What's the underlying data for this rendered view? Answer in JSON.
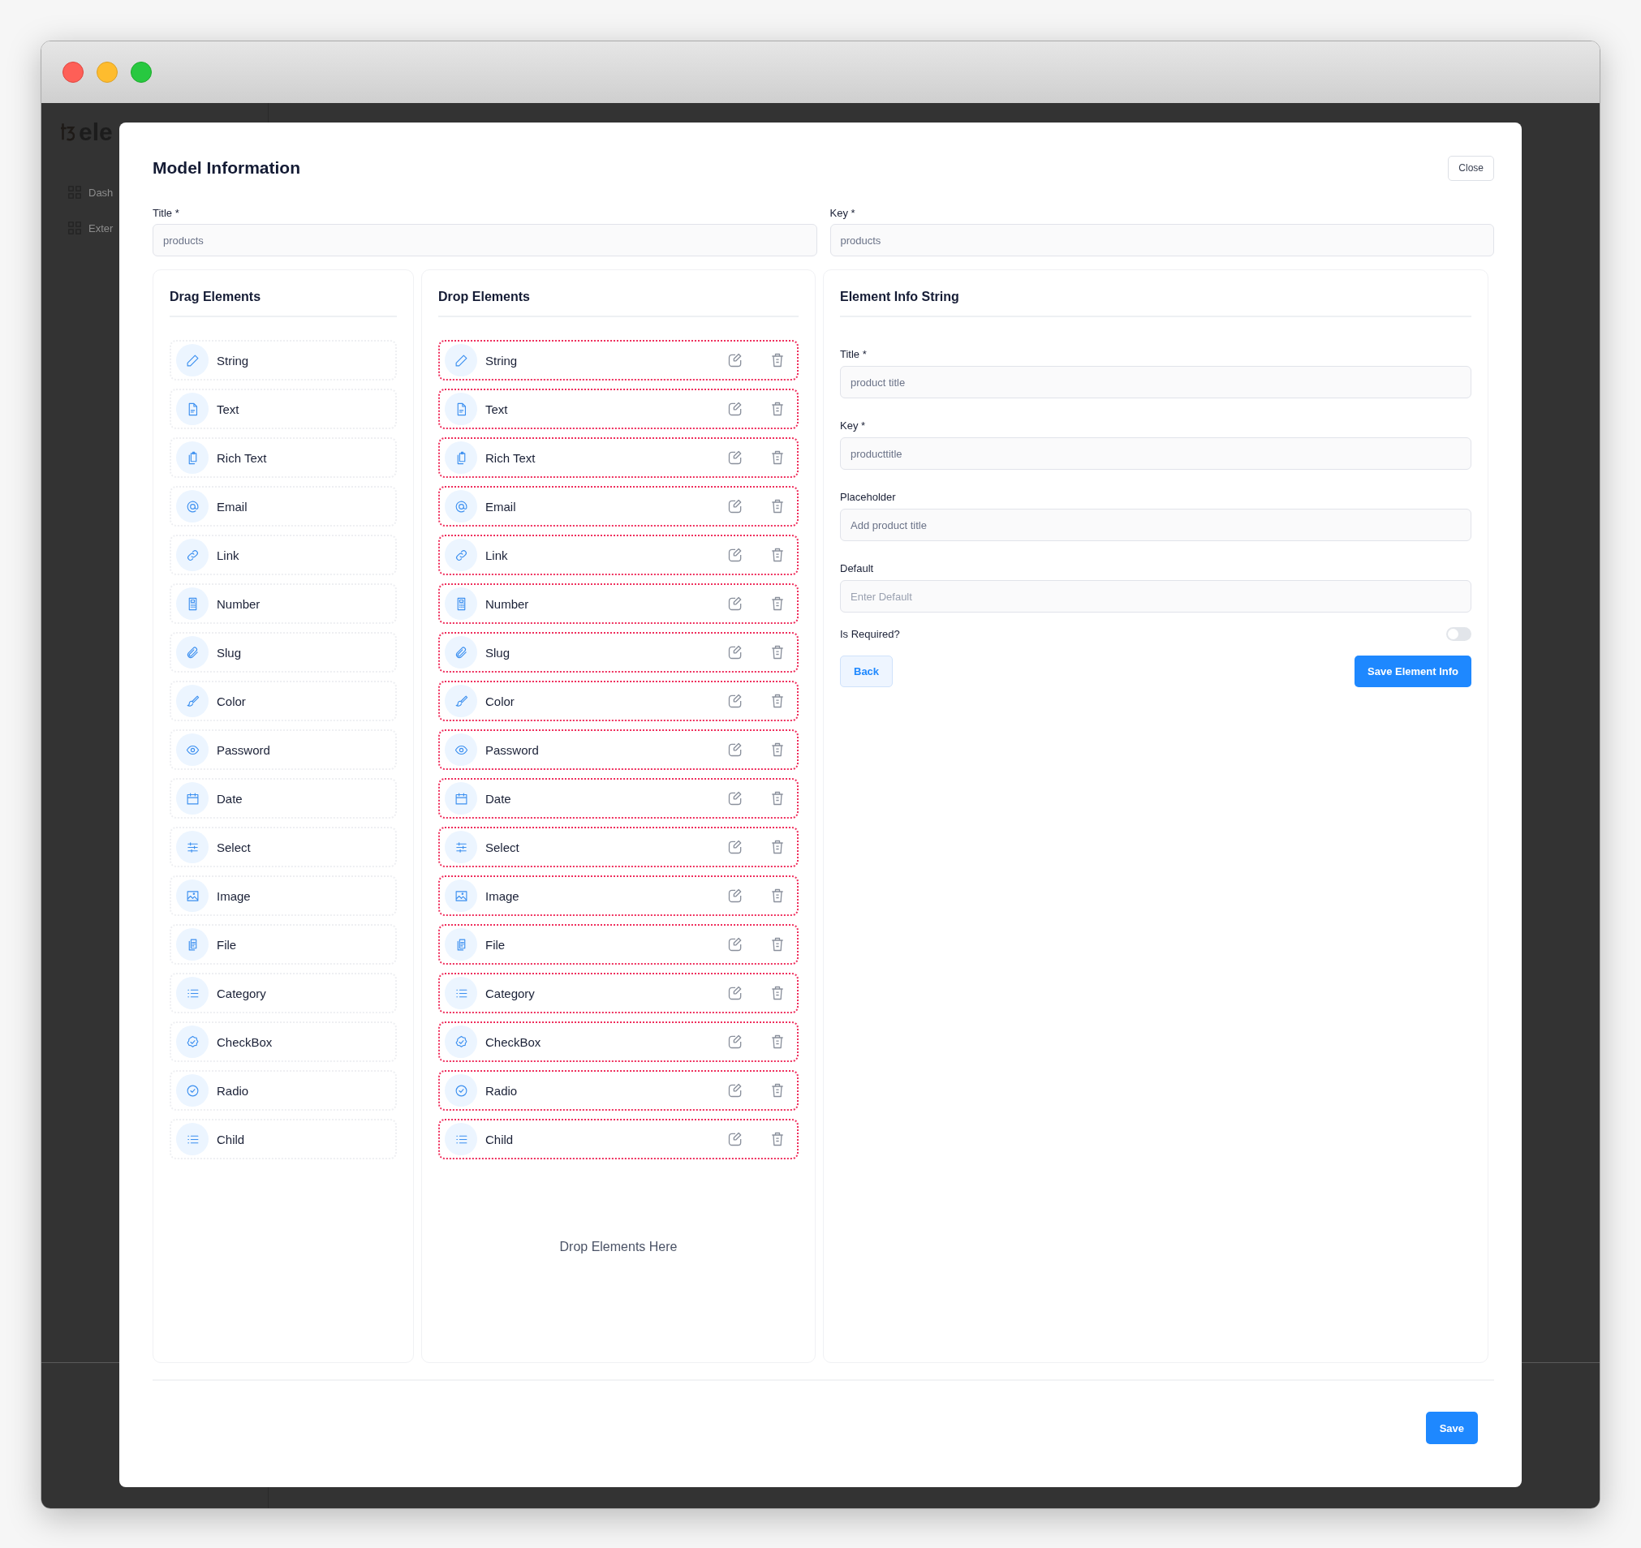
{
  "background": {
    "logo": "ele",
    "nav": [
      {
        "label": "Dash"
      },
      {
        "label": "Exter"
      }
    ]
  },
  "modal": {
    "title": "Model Information",
    "close": "Close",
    "fields": [
      {
        "label": "Title *",
        "value": "products"
      },
      {
        "label": "Key *",
        "value": "products"
      }
    ],
    "drag_panel": {
      "title": "Drag Elements",
      "items": [
        {
          "label": "String"
        },
        {
          "label": "Text"
        },
        {
          "label": "Rich Text"
        },
        {
          "label": "Email"
        },
        {
          "label": "Link"
        },
        {
          "label": "Number"
        },
        {
          "label": "Slug"
        },
        {
          "label": "Color"
        },
        {
          "label": "Password"
        },
        {
          "label": "Date"
        },
        {
          "label": "Select"
        },
        {
          "label": "Image"
        },
        {
          "label": "File"
        },
        {
          "label": "Category"
        },
        {
          "label": "CheckBox"
        },
        {
          "label": "Radio"
        },
        {
          "label": "Child"
        }
      ]
    },
    "drop_panel": {
      "title": "Drop Elements",
      "items": [
        {
          "label": "String"
        },
        {
          "label": "Text"
        },
        {
          "label": "Rich Text"
        },
        {
          "label": "Email"
        },
        {
          "label": "Link"
        },
        {
          "label": "Number"
        },
        {
          "label": "Slug"
        },
        {
          "label": "Color"
        },
        {
          "label": "Password"
        },
        {
          "label": "Date"
        },
        {
          "label": "Select"
        },
        {
          "label": "Image"
        },
        {
          "label": "File"
        },
        {
          "label": "Category"
        },
        {
          "label": "CheckBox"
        },
        {
          "label": "Radio"
        },
        {
          "label": "Child"
        }
      ],
      "hint": "Drop Elements Here"
    },
    "info_panel": {
      "title": "Element Info String",
      "fields": [
        {
          "label": "Title *",
          "value": "product title"
        },
        {
          "label": "Key *",
          "value": "producttitle"
        },
        {
          "label": "Placeholder",
          "value": "Add product title"
        },
        {
          "label": "Default",
          "placeholder": "Enter Default"
        }
      ],
      "toggle": {
        "label": "Is Required?",
        "on": false
      },
      "back": "Back",
      "save": "Save Element Info"
    },
    "save": "Save"
  }
}
